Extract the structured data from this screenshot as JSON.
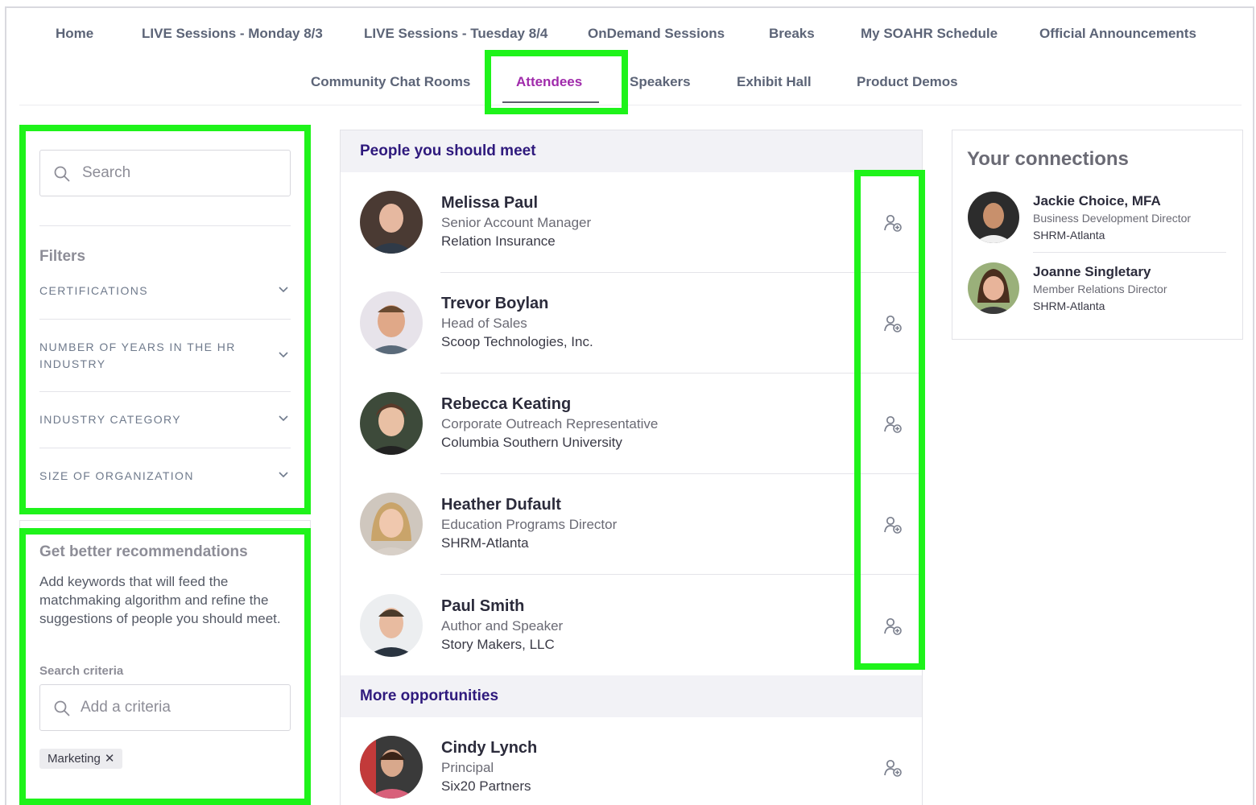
{
  "nav": {
    "row1": [
      "Home",
      "LIVE Sessions - Monday 8/3",
      "LIVE Sessions - Tuesday 8/4",
      "OnDemand Sessions",
      "Breaks",
      "My SOAHR Schedule",
      "Official Announcements"
    ],
    "row2": [
      "Community Chat Rooms",
      "Attendees",
      "Speakers",
      "Exhibit Hall",
      "Product Demos"
    ],
    "active": "Attendees"
  },
  "sidebar": {
    "search_placeholder": "Search",
    "filters_title": "Filters",
    "filters": [
      "CERTIFICATIONS",
      "NUMBER OF YEARS IN THE HR INDUSTRY",
      "INDUSTRY CATEGORY",
      "SIZE OF ORGANIZATION"
    ],
    "recommendations": {
      "title": "Get better recommendations",
      "description": "Add keywords that will feed the matchmaking algorithm and refine the suggestions of people you should meet.",
      "criteria_label": "Search criteria",
      "criteria_placeholder": "Add a criteria",
      "tags": [
        {
          "label": "Marketing",
          "remove": "✕"
        }
      ]
    }
  },
  "main": {
    "people_title": "People you should meet",
    "people": [
      {
        "name": "Melissa Paul",
        "title": "Senior Account Manager",
        "org": "Relation Insurance"
      },
      {
        "name": "Trevor Boylan",
        "title": "Head of Sales",
        "org": "Scoop Technologies, Inc."
      },
      {
        "name": "Rebecca Keating",
        "title": "Corporate Outreach Representative",
        "org": "Columbia Southern University"
      },
      {
        "name": "Heather Dufault",
        "title": "Education Programs Director",
        "org": "SHRM-Atlanta"
      },
      {
        "name": "Paul Smith",
        "title": "Author and Speaker",
        "org": "Story Makers, LLC"
      }
    ],
    "more_title": "More opportunities",
    "more": [
      {
        "name": "Cindy Lynch",
        "title": "Principal",
        "org": "Six20 Partners"
      }
    ]
  },
  "connections": {
    "title": "Your connections",
    "items": [
      {
        "name": "Jackie Choice, MFA",
        "title": "Business Development Director",
        "org": "SHRM-Atlanta"
      },
      {
        "name": "Joanne Singletary",
        "title": "Member Relations Director",
        "org": "SHRM-Atlanta"
      }
    ]
  },
  "colors": {
    "highlight": "#1ef31a",
    "active_tab": "#a02bab",
    "section_title": "#2f1a7d"
  }
}
